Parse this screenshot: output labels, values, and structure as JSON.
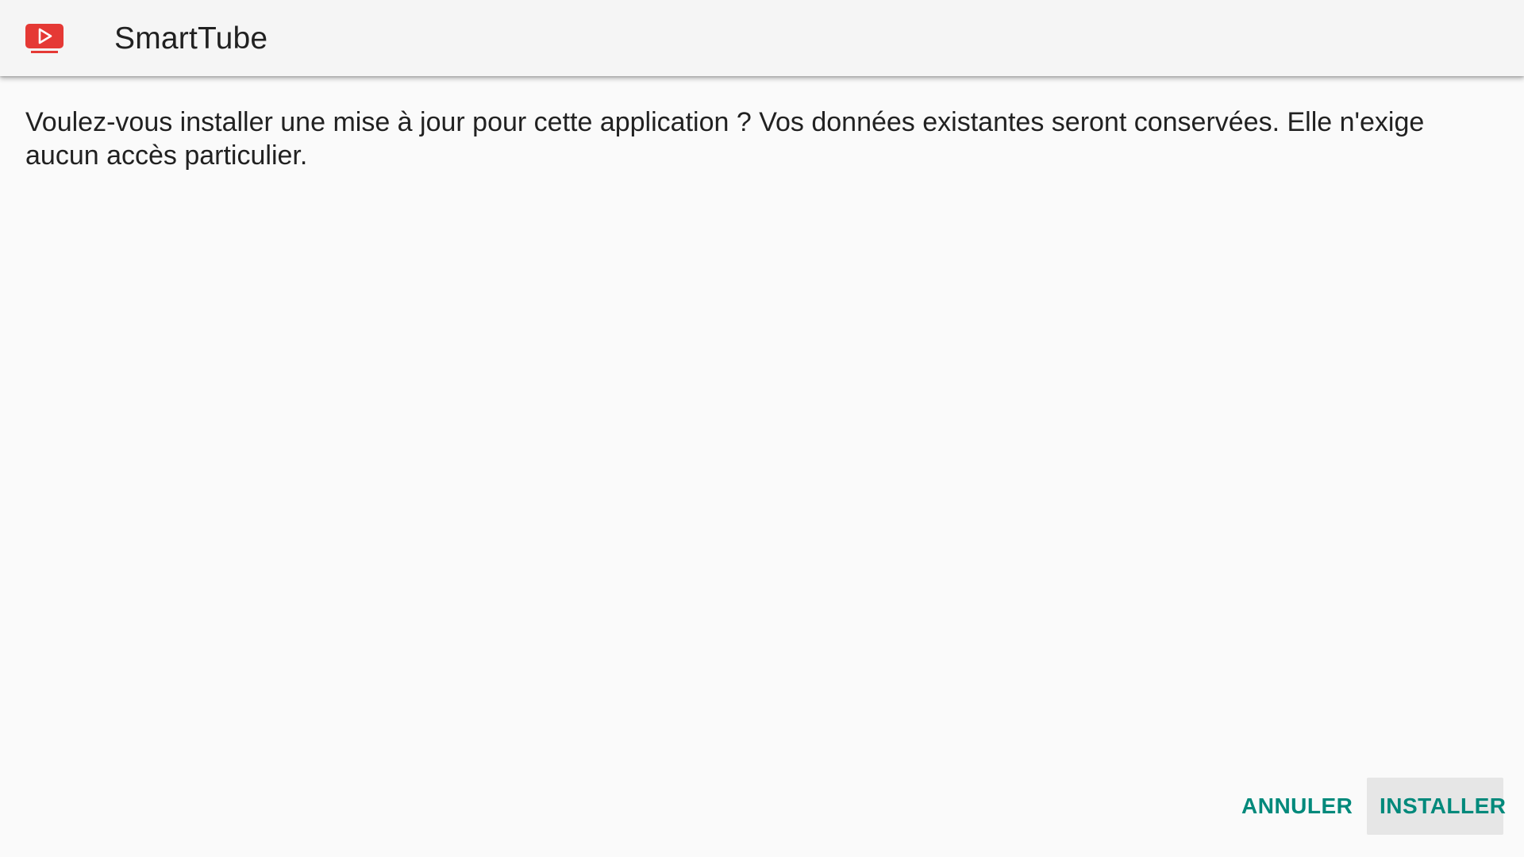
{
  "header": {
    "app_name": "SmartTube",
    "icon": "smarttube-tv-play-icon",
    "icon_color": "#e53935"
  },
  "content": {
    "message": "Voulez-vous installer une mise à jour pour cette application ? Vos données existantes seront conservées. Elle n'exige aucun accès particulier."
  },
  "actions": {
    "cancel_label": "ANNULER",
    "install_label": "INSTALLER",
    "accent_color": "#00897b"
  }
}
